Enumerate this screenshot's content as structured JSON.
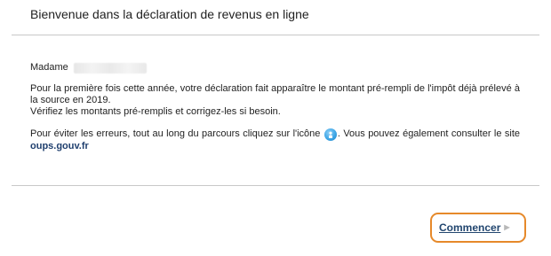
{
  "header": {
    "title": "Bienvenue dans la déclaration de revenus en ligne"
  },
  "greeting": {
    "salutation": "Madame"
  },
  "message": {
    "line1": "Pour la première fois cette année, votre déclaration fait apparaître le montant pré-rempli de l'impôt déjà prélevé à la source en 2019.",
    "line2": "Vérifiez les montants pré-remplis et corrigez-les si besoin."
  },
  "help": {
    "before_icon": "Pour éviter les erreurs, tout au long du parcours cliquez sur l'icône",
    "after_icon": ". Vous pouvez également consulter le site",
    "site_link": "oups.gouv.fr",
    "icon": "help-icon"
  },
  "actions": {
    "start_label": "Commencer",
    "start_icon": "chevron-right-icon"
  },
  "colors": {
    "accent_outline": "#e6892a",
    "link": "#1f3f6e",
    "button_text": "#22466f",
    "help_icon": "#3ea6e6"
  }
}
